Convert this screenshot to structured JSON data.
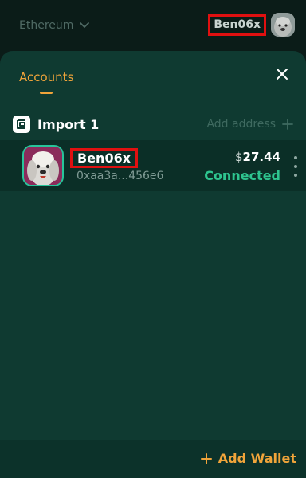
{
  "topbar": {
    "network": "Ethereum",
    "username": "Ben06x"
  },
  "panel": {
    "tab_accounts": "Accounts",
    "group": {
      "title": "Import 1",
      "add_address": "Add address"
    },
    "account": {
      "name": "Ben06x",
      "address": "0xaa3a...456e6",
      "balance_currency": "$",
      "balance_value": "27.44",
      "status": "Connected"
    },
    "footer": {
      "add_wallet": "Add Wallet"
    }
  },
  "colors": {
    "accent": "#f0a43a",
    "connected": "#2ec48f",
    "panel_bg": "#0f3a31"
  }
}
